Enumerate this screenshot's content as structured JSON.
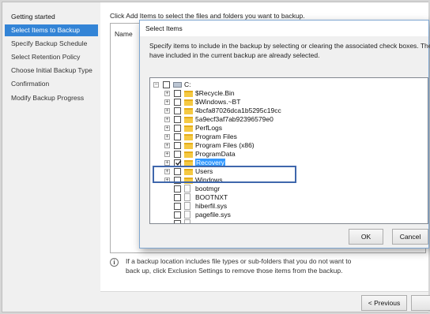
{
  "wizard": {
    "nav": [
      {
        "label": "Getting started",
        "state": "current"
      },
      {
        "label": "Select Items to Backup",
        "state": "selected"
      },
      {
        "label": "Specify Backup Schedule",
        "state": "normal"
      },
      {
        "label": "Select Retention Policy",
        "state": "normal"
      },
      {
        "label": "Choose Initial Backup Type",
        "state": "normal"
      },
      {
        "label": "Confirmation",
        "state": "normal"
      },
      {
        "label": "Modify Backup Progress",
        "state": "normal"
      }
    ],
    "instruction": "Click Add Items to select the files and folders you want to backup.",
    "list_column": "Name",
    "info_text": "If a backup location includes file types or sub-folders that you do not want to back up, click Exclusion Settings to remove those items from the backup.",
    "prev_button": "< Previous",
    "next_button": ""
  },
  "dialog": {
    "title": "Select Items",
    "description_line1": "Specify items to include in the backup by selecting or clearing the associated check boxes. The items that you",
    "description_line2": "have included in the current backup are already selected.",
    "ok_label": "OK",
    "cancel_label": "Cancel",
    "tree": [
      {
        "label": "C:",
        "type": "drive",
        "checked": false,
        "expander": "minus",
        "selected": false
      },
      {
        "label": "$Recycle.Bin",
        "type": "folder",
        "checked": false,
        "expander": "plus",
        "selected": false
      },
      {
        "label": "$Windows.~BT",
        "type": "folder",
        "checked": false,
        "expander": "plus",
        "selected": false
      },
      {
        "label": "4bcfa87026dca1b5295c19cc",
        "type": "folder",
        "checked": false,
        "expander": "plus",
        "selected": false
      },
      {
        "label": "5a9ecf3af7ab92396579e0",
        "type": "folder",
        "checked": false,
        "expander": "plus",
        "selected": false
      },
      {
        "label": "PerfLogs",
        "type": "folder",
        "checked": false,
        "expander": "plus",
        "selected": false
      },
      {
        "label": "Program Files",
        "type": "folder",
        "checked": false,
        "expander": "plus",
        "selected": false
      },
      {
        "label": "Program Files (x86)",
        "type": "folder",
        "checked": false,
        "expander": "plus",
        "selected": false
      },
      {
        "label": "ProgramData",
        "type": "folder",
        "checked": false,
        "expander": "plus",
        "selected": false
      },
      {
        "label": "Recovery",
        "type": "folder",
        "checked": true,
        "expander": "plus",
        "selected": true
      },
      {
        "label": "Users",
        "type": "folder",
        "checked": false,
        "expander": "plus",
        "selected": false
      },
      {
        "label": "Windows",
        "type": "folder",
        "checked": false,
        "expander": "plus",
        "selected": false
      },
      {
        "label": "bootmgr",
        "type": "file",
        "checked": false,
        "expander": "none",
        "selected": false
      },
      {
        "label": "BOOTNXT",
        "type": "file",
        "checked": false,
        "expander": "none",
        "selected": false
      },
      {
        "label": "hiberfil.sys",
        "type": "file",
        "checked": false,
        "expander": "none",
        "selected": false
      },
      {
        "label": "pagefile.sys",
        "type": "file",
        "checked": false,
        "expander": "none",
        "selected": false
      },
      {
        "label": "",
        "type": "file",
        "checked": false,
        "expander": "none",
        "selected": false
      }
    ]
  },
  "colors": {
    "nav_selected": "#3384d6",
    "tree_selection": "#3399ff",
    "callout_border": "#3f67ac"
  }
}
